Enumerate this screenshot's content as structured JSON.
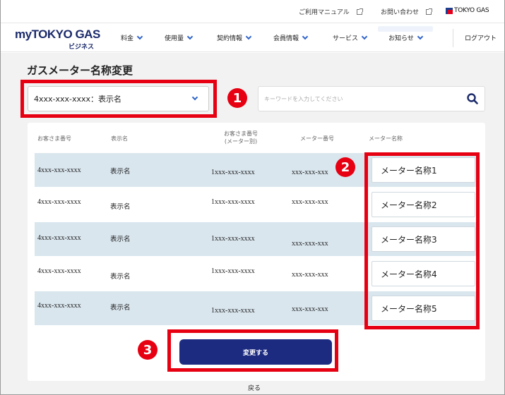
{
  "utility": {
    "manual_label": "ご利用マニュアル",
    "contact_label": "お問い合わせ",
    "corp_logo_text": "TOKYO GAS"
  },
  "header": {
    "brand_my": "my",
    "brand_name": "TOKYO GAS",
    "brand_sub": "ビジネス",
    "nav": [
      "料金",
      "使用量",
      "契約情報",
      "会員情報",
      "サービス",
      "お知らせ"
    ],
    "logout_label": "ログアウト"
  },
  "main": {
    "title": "ガスメーター名称変更",
    "select_value": "4xxx-xxx-xxxx：表示名",
    "search_placeholder": "キーワードを入力してください",
    "table": {
      "headers": [
        "お客さま番号",
        "表示名",
        "お客さま番号\n(メーター別)",
        "メーター番号",
        "メーター名称"
      ],
      "rows": [
        {
          "customer_no": "4xxx-xxx-xxxx",
          "display_name": "表示名",
          "meter_customer_no": "1xxx-xxx-xxxx",
          "meter_no": "xxx-xxx-xxx",
          "meter_name": "メーター名称1"
        },
        {
          "customer_no": "4xxx-xxx-xxxx",
          "display_name": "表示名",
          "meter_customer_no": "1xxx-xxx-xxxx",
          "meter_no": "xxx-xxx-xxx",
          "meter_name": "メーター名称2"
        },
        {
          "customer_no": "4xxx-xxx-xxxx",
          "display_name": "表示名",
          "meter_customer_no": "1xxx-xxx-xxxx",
          "meter_no": "xxx-xxx-xxx",
          "meter_name": "メーター名称3"
        },
        {
          "customer_no": "4xxx-xxx-xxxx",
          "display_name": "表示名",
          "meter_customer_no": "1xxx-xxx-xxxx",
          "meter_no": "xxx-xxx-xxx",
          "meter_name": "メーター名称4"
        },
        {
          "customer_no": "4xxx-xxx-xxxx",
          "display_name": "表示名",
          "meter_customer_no": "1xxx-xxx-xxxx",
          "meter_no": "xxx-xxx-xxx",
          "meter_name": "メーター名称5"
        }
      ]
    },
    "submit_label": "変更する",
    "back_label": "戻る"
  },
  "annotations": {
    "marker_1": "1",
    "marker_2": "2",
    "marker_3": "3",
    "highlight_color": "#e60012"
  },
  "colors": {
    "brand_navy": "#1b2a6b",
    "button_navy": "#1c2b80",
    "accent_blue": "#2f63c8",
    "row_shade": "#d9e6ee"
  }
}
